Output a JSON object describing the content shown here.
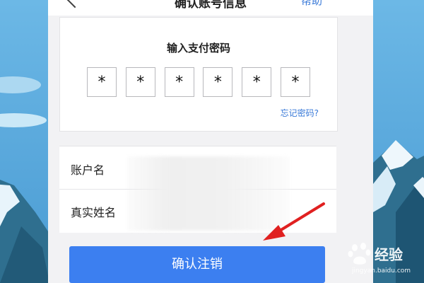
{
  "nav": {
    "title": "确认账号信息",
    "help": "帮助"
  },
  "password": {
    "heading": "输入支付密码",
    "digits": [
      "*",
      "*",
      "*",
      "*",
      "*",
      "*"
    ],
    "forgot": "忘记密码?"
  },
  "account": {
    "name_label": "账户名",
    "real_name_label": "真实姓名"
  },
  "actions": {
    "confirm_label": "确认注销"
  },
  "watermark": {
    "brand": "经验",
    "url": "jingyan.baidu.com"
  },
  "colors": {
    "accent": "#3c7ff0",
    "link": "#3a7ad8",
    "arrow": "#e02020"
  }
}
